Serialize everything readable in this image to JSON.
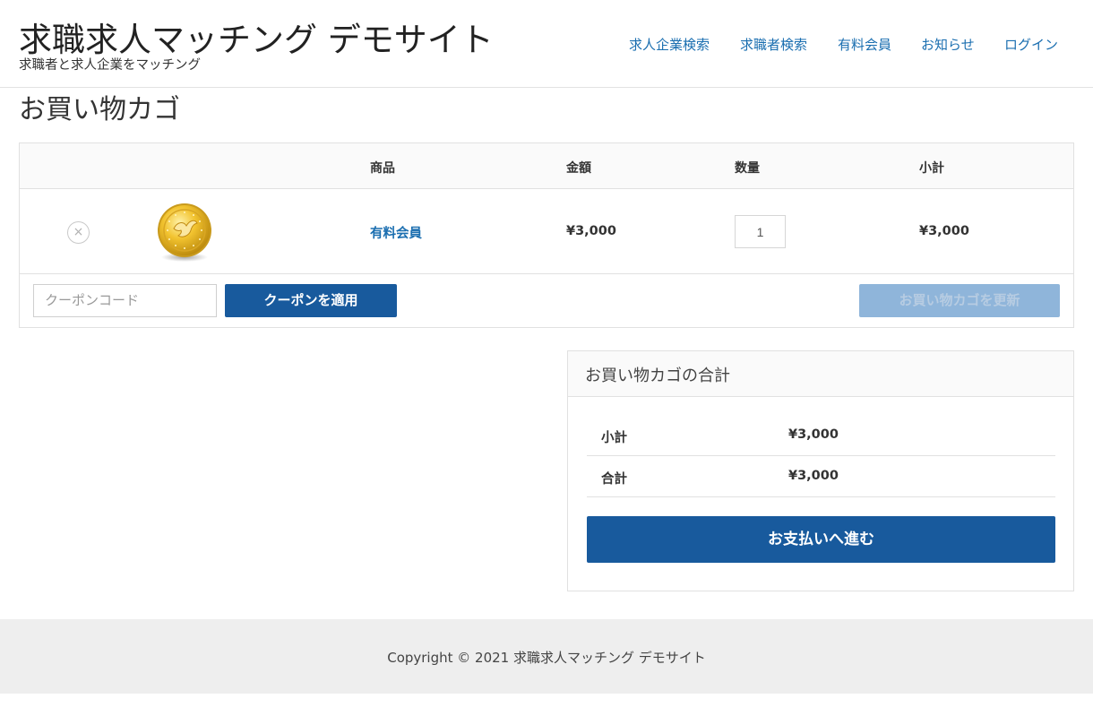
{
  "header": {
    "site_title": "求職求人マッチング デモサイト",
    "tagline": "求職者と求人企業をマッチング",
    "nav": [
      {
        "label": "求人企業検索"
      },
      {
        "label": "求職者検索"
      },
      {
        "label": "有料会員"
      },
      {
        "label": "お知らせ"
      },
      {
        "label": "ログイン"
      }
    ]
  },
  "page": {
    "title": "お買い物カゴ"
  },
  "cart": {
    "columns": {
      "product": "商品",
      "price": "金額",
      "quantity": "数量",
      "subtotal": "小計"
    },
    "items": [
      {
        "remove_icon": "close-icon",
        "thumbnail_icon": "gold-coin-icon",
        "name": "有料会員",
        "price": "¥3,000",
        "quantity": "1",
        "subtotal": "¥3,000"
      }
    ],
    "coupon_placeholder": "クーポンコード",
    "apply_coupon_label": "クーポンを適用",
    "update_cart_label": "お買い物カゴを更新"
  },
  "totals": {
    "title": "お買い物カゴの合計",
    "rows": [
      {
        "label": "小計",
        "value": "¥3,000"
      },
      {
        "label": "合計",
        "value": "¥3,000"
      }
    ],
    "checkout_label": "お支払いへ進む"
  },
  "footer": {
    "copyright": "Copyright © 2021 求職求人マッチング デモサイト"
  },
  "colors": {
    "link": "#1a6eb0",
    "primary_button": "#185a9d",
    "disabled_button": "#8fb5da",
    "footer_bg": "#eeeeee"
  }
}
